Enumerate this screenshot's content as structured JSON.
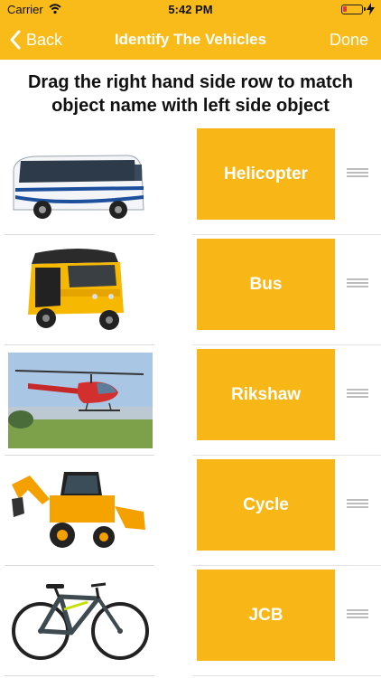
{
  "status_bar": {
    "carrier": "Carrier",
    "time": "5:42 PM"
  },
  "nav": {
    "back_label": "Back",
    "title": "Identify The Vehicles",
    "done_label": "Done"
  },
  "instructions": "Drag the right hand side row to match object name with left side object",
  "rows": [
    {
      "image": "bus",
      "answer": "Helicopter"
    },
    {
      "image": "auto-rickshaw",
      "answer": "Bus"
    },
    {
      "image": "helicopter",
      "answer": "Rikshaw"
    },
    {
      "image": "jcb-backhoe",
      "answer": "Cycle"
    },
    {
      "image": "bicycle",
      "answer": "JCB"
    }
  ],
  "colors": {
    "accent": "#f8bb1a",
    "tile": "#f8b716",
    "tile_text": "#ffffff"
  }
}
